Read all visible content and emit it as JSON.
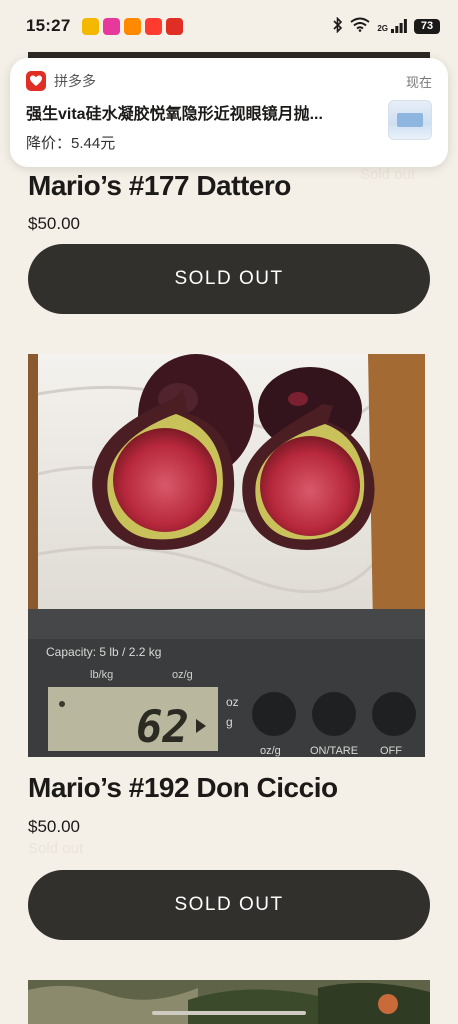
{
  "status_bar": {
    "time": "15:27",
    "battery": "73",
    "signal_label": "2G",
    "app_icons": [
      {
        "name": "app-icon-1",
        "label": "",
        "color": "#f5b800"
      },
      {
        "name": "app-icon-2",
        "label": "",
        "color": "#e6399b"
      },
      {
        "name": "app-icon-3",
        "label": "",
        "color": "#ff8a00"
      },
      {
        "name": "app-icon-4",
        "label": "",
        "color": "#ff3b30"
      },
      {
        "name": "app-icon-5",
        "label": "",
        "color": "#e02e24"
      }
    ]
  },
  "notification": {
    "app_name": "拼多多",
    "time": "现在",
    "title": "强生vita硅水凝胶悦氧隐形近视眼镜月抛...",
    "price_text": "降价：5.44元"
  },
  "products": [
    {
      "title": "Mario’s #177 Dattero",
      "price": "$50.00",
      "ghost_label": "Sold out",
      "button_label": "SOLD OUT"
    },
    {
      "title": "Mario’s #192 Don Ciccio",
      "price": "$50.00",
      "ghost_label": "Sold out",
      "button_label": "SOLD OUT",
      "scale": {
        "capacity": "Capacity: 5 lb / 2.2 kg",
        "unit_left": "lb/kg",
        "unit_right": "oz/g",
        "display": "62",
        "display_unit_top": "oz",
        "display_unit_bottom": "g",
        "button_labels": [
          "oz/g",
          "ON/TARE",
          "OFF"
        ]
      }
    }
  ],
  "colors": {
    "background": "#f4efe7",
    "button": "#32302d",
    "button_text": "#ffffff",
    "brand_pdd": "#e02e24"
  }
}
